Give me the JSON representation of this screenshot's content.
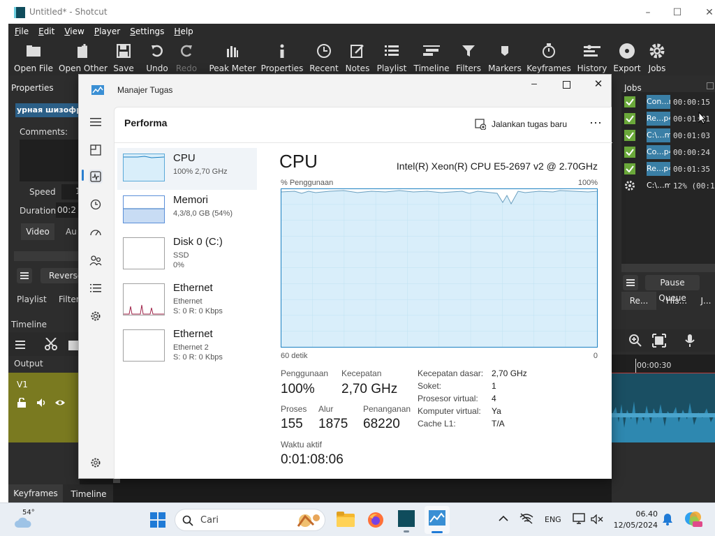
{
  "shotcut": {
    "window_title": "Untitled* - Shotcut",
    "menu": [
      "File",
      "Edit",
      "View",
      "Player",
      "Settings",
      "Help"
    ],
    "toolbar": [
      {
        "label": "Open File",
        "icon": "folder-icon"
      },
      {
        "label": "Open Other",
        "icon": "open-other-icon"
      },
      {
        "label": "Save",
        "icon": "save-icon"
      },
      {
        "label": "Undo",
        "icon": "undo-icon"
      },
      {
        "label": "Redo",
        "icon": "redo-icon",
        "disabled": true
      },
      {
        "label": "Peak Meter",
        "icon": "peak-meter-icon"
      },
      {
        "label": "Properties",
        "icon": "info-icon"
      },
      {
        "label": "Recent",
        "icon": "clock-icon"
      },
      {
        "label": "Notes",
        "icon": "notes-icon"
      },
      {
        "label": "Playlist",
        "icon": "list-icon"
      },
      {
        "label": "Timeline",
        "icon": "timeline-icon"
      },
      {
        "label": "Filters",
        "icon": "funnel-icon"
      },
      {
        "label": "Markers",
        "icon": "marker-icon"
      },
      {
        "label": "Keyframes",
        "icon": "stopwatch-icon"
      },
      {
        "label": "History",
        "icon": "history-icon"
      },
      {
        "label": "Export",
        "icon": "disc-icon"
      },
      {
        "label": "Jobs",
        "icon": "gear-icon"
      }
    ],
    "left": {
      "properties_title": "Properties",
      "clip_name": "урная шизофре",
      "comments_label": "Comments:",
      "speed_label": "Speed",
      "speed_value": "1",
      "duration_label": "Duration",
      "duration_value": "00:2",
      "tab_video": "Video",
      "tab_audio": "Au",
      "reverse_button": "Reverse",
      "tab_playlist": "Playlist",
      "tab_filters": "Filter",
      "timeline_title": "Timeline",
      "output_label": "Output",
      "track_label": "V1",
      "tab_keyframes": "Keyframes",
      "tab_timeline": "Timeline"
    },
    "jobs": {
      "title": "Jobs",
      "items": [
        {
          "name": "Con...r",
          "time": "00:00:15",
          "done": true
        },
        {
          "name": "Re...p4",
          "time": "00:01:31",
          "done": true
        },
        {
          "name": "C:\\...m",
          "time": "00:01:03",
          "done": true
        },
        {
          "name": "Co...p4",
          "time": "00:00:24",
          "done": true
        },
        {
          "name": "Re...p4",
          "time": "00:01:35",
          "done": true
        },
        {
          "name": "C:\\...m",
          "time": "12% (00:1",
          "done": false
        }
      ],
      "pause_button": "Pause Queue",
      "tab1": "Re...",
      "tab2": "His...",
      "tab3": "J..."
    },
    "ruler_time": "00:00:30"
  },
  "task_manager": {
    "title": "Manajer Tugas",
    "page_title": "Performa",
    "run_task_label": "Jalankan tugas baru",
    "sidebar": [
      {
        "name": "CPU",
        "line1": "100%  2,70 GHz",
        "line2": ""
      },
      {
        "name": "Memori",
        "line1": "4,3/8,0 GB (54%)",
        "line2": ""
      },
      {
        "name": "Disk 0 (C:)",
        "line1": "SSD",
        "line2": "0%"
      },
      {
        "name": "Ethernet",
        "line1": "Ethernet",
        "line2": "S: 0  R: 0 Kbps"
      },
      {
        "name": "Ethernet",
        "line1": "Ethernet 2",
        "line2": "S: 0  R: 0 Kbps"
      }
    ],
    "detail": {
      "heading": "CPU",
      "cpu_model": "Intel(R) Xeon(R) CPU E5-2697 v2 @ 2.70GHz",
      "graph_label": "% Penggunaan",
      "graph_max": "100%",
      "graph_span": "60 detik",
      "graph_min": "0",
      "usage_label": "Penggunaan",
      "usage_value": "100%",
      "speed_label": "Kecepatan",
      "speed_value": "2,70 GHz",
      "process_label": "Proses",
      "process_value": "155",
      "thread_label": "Alur",
      "thread_value": "1875",
      "handle_label": "Penanganan",
      "handle_value": "68220",
      "uptime_label": "Waktu aktif",
      "uptime_value": "0:01:08:06",
      "specs": [
        {
          "k": "Kecepatan dasar:",
          "v": "2,70 GHz"
        },
        {
          "k": "Soket:",
          "v": "1"
        },
        {
          "k": "Prosesor virtual:",
          "v": "4"
        },
        {
          "k": "Komputer virtual:",
          "v": "Ya"
        },
        {
          "k": "Cache L1:",
          "v": "T/A"
        }
      ]
    }
  },
  "taskbar": {
    "weather": "54°",
    "search_placeholder": "Cari",
    "lang": "ENG",
    "time": "06.40",
    "date": "12/05/2024"
  },
  "colors": {
    "cpu_graph_fill": "#d9eefa",
    "cpu_graph_line": "#1a7fc1",
    "ethernet_spike": "#a0244a",
    "job_bar": "#3a7fa6",
    "track_bg": "#7a7a20"
  }
}
